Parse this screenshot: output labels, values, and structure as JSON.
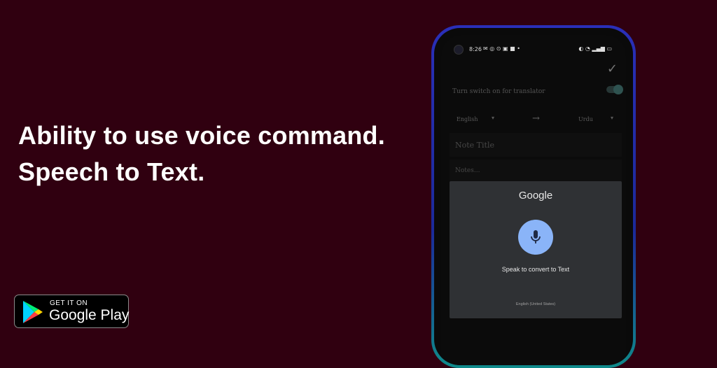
{
  "promo": {
    "headline_line1": "Ability to use voice command.",
    "headline_line2": "Speech to Text."
  },
  "badge": {
    "get_it_on": "GET IT ON",
    "store": "Google Play"
  },
  "status_bar": {
    "time": "8:26",
    "icons_left": [
      "mail-icon",
      "notification-icon",
      "app-icon",
      "square-icon",
      "dot-icon"
    ],
    "icons_right": [
      "alarm-icon",
      "wifi-icon",
      "signal-icon",
      "battery-icon"
    ]
  },
  "app": {
    "confirm_icon": "checkmark-icon",
    "translator_label": "Turn switch on for translator",
    "translator_on": true,
    "source_language": "English",
    "target_language": "Urdu",
    "note_title_placeholder": "Note Title",
    "notes_placeholder": "Notes..."
  },
  "speech_dialog": {
    "brand": "Google",
    "prompt": "Speak to convert to Text",
    "language": "English (United States)",
    "colors": {
      "mic_bg": "#8ab4f8",
      "dialog_bg": "#2f3134"
    }
  },
  "colors": {
    "background": "#300010"
  }
}
